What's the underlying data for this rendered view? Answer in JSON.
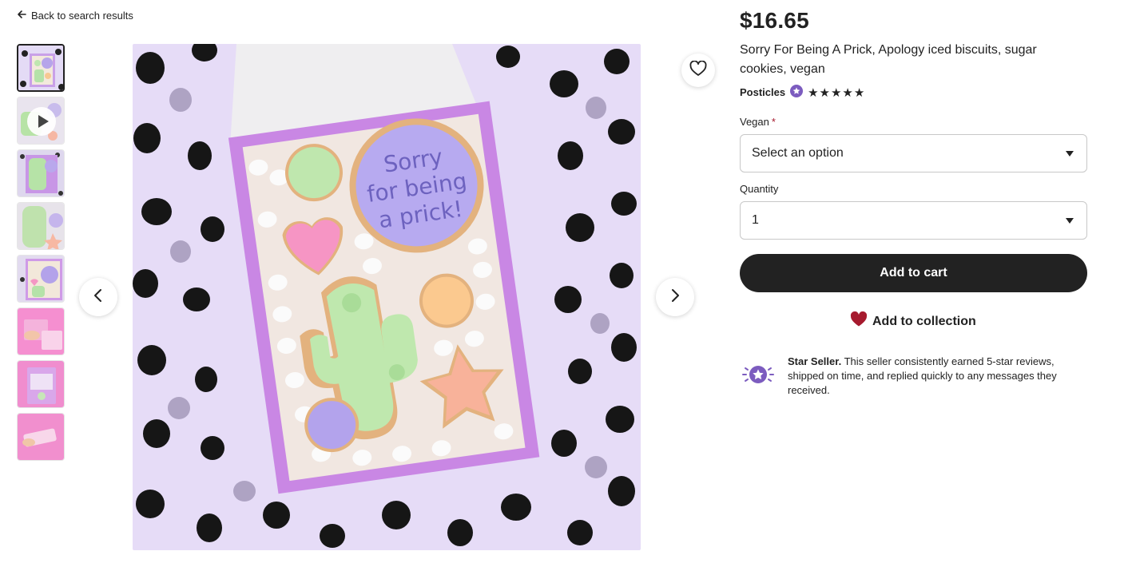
{
  "nav": {
    "back_label": "Back to search results"
  },
  "gallery": {
    "thumbnail_count": 8,
    "active_index": 0,
    "video_thumbnail_index": 1,
    "main_image": {
      "description_icons": "cookie-box-photo",
      "cookie_text_line1": "Sorry",
      "cookie_text_line2": "for being",
      "cookie_text_line3": "a prick!"
    }
  },
  "product": {
    "price": "$16.65",
    "title": "Sorry For Being A Prick, Apology iced biscuits, sugar cookies, vegan",
    "shop_name": "Posticles",
    "rating_stars": "★★★★★",
    "rating_value": 5
  },
  "options": {
    "vegan_label": "Vegan",
    "required_mark": "*",
    "vegan_value": "Select an option",
    "quantity_label": "Quantity",
    "quantity_value": "1"
  },
  "actions": {
    "add_to_cart": "Add to cart",
    "add_to_collection": "Add to collection"
  },
  "star_seller": {
    "title": "Star Seller.",
    "body": " This seller consistently earned 5-star reviews, shipped on time, and replied quickly to any messages they received."
  },
  "colors": {
    "primary_dark": "#222222",
    "star_seller_purple": "#7c5cbf",
    "heart_red": "#a61a2e",
    "image_lavender": "#e6dcf7"
  }
}
